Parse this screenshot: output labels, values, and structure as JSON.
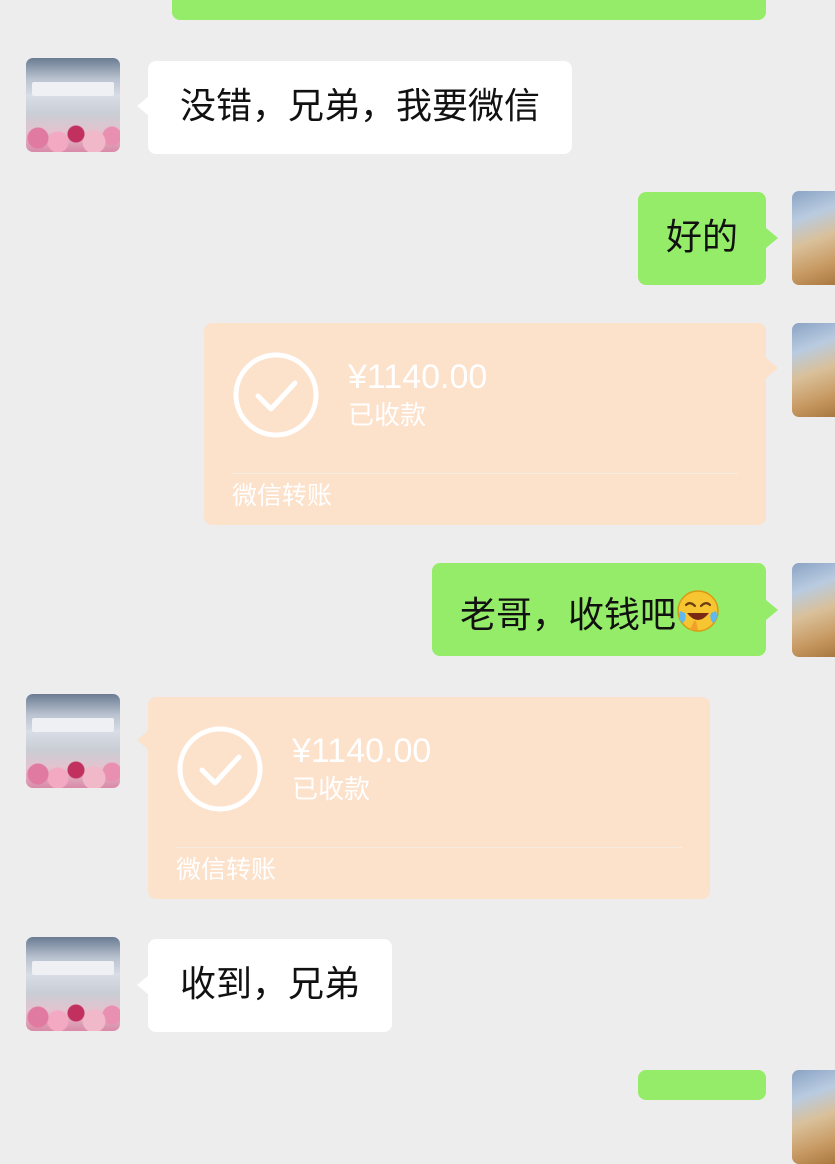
{
  "messages": {
    "m1": {
      "text": "没错，兄弟，我要微信"
    },
    "m2": {
      "text": "好的"
    },
    "m3": {
      "amount": "¥1140.00",
      "status": "已收款",
      "footer": "微信转账"
    },
    "m4": {
      "text": "老哥，收钱吧",
      "emoji": "laughing-crying-emoji"
    },
    "m5": {
      "amount": "¥1140.00",
      "status": "已收款",
      "footer": "微信转账"
    },
    "m6": {
      "text": "收到，兄弟"
    }
  },
  "colors": {
    "background": "#ededed",
    "bubble_self": "#95ec69",
    "bubble_other": "#ffffff",
    "transfer_card": "#fce1cb"
  }
}
